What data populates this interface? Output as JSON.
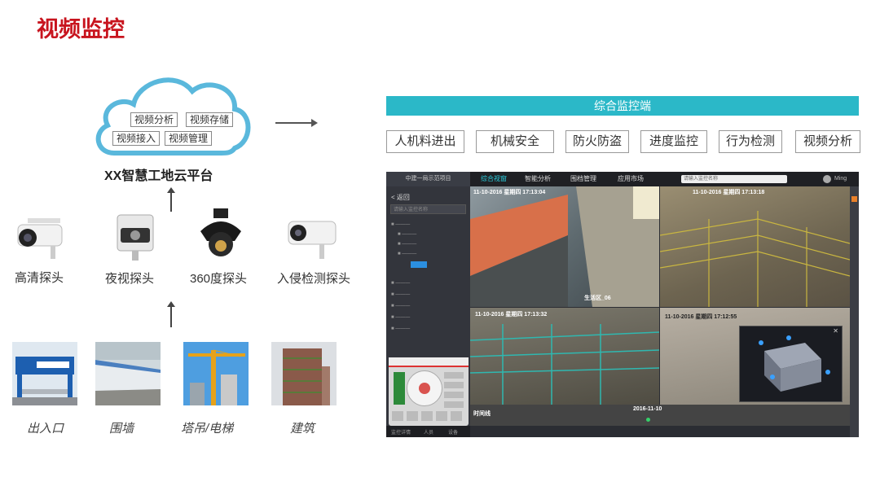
{
  "page_title": "视频监控",
  "cloud": {
    "tags": [
      "视频分析",
      "视频存储",
      "视频接入",
      "视频管理"
    ],
    "platform_name": "XX智慧工地云平台"
  },
  "cameras": [
    {
      "label": "高清探头",
      "icon": "bullet-camera-icon"
    },
    {
      "label": "夜视探头",
      "icon": "night-vision-camera-icon"
    },
    {
      "label": "360度探头",
      "icon": "dome-camera-icon"
    },
    {
      "label": "入侵检测探头",
      "icon": "intrusion-camera-icon"
    }
  ],
  "sites": [
    "出入口",
    "围墙",
    "塔吊/电梯",
    "建筑"
  ],
  "console": {
    "banner": "综合监控端",
    "functions": [
      "人机料进出",
      "机械安全",
      "防火防盗",
      "进度监控",
      "行为检测",
      "视频分析"
    ]
  },
  "screen": {
    "project": "中建一局示范项目",
    "tabs": [
      "综合视窗",
      "智能分析",
      "围档管理",
      "应用市场"
    ],
    "search_placeholder": "请输入监控名称",
    "user": "Ming",
    "back": "< 返回",
    "tree_search": "请输入监控名称",
    "timeline_label": "时间线",
    "timeline_date": "2016-11-10",
    "bottom_tabs": [
      "监控详情",
      "人员",
      "设备"
    ],
    "stamps": [
      "11-10-2016 星期四 17:13:04",
      "11-10-2016 星期四 17:13:18",
      "11-10-2016 星期四 17:13:32",
      "11-10-2016 星期四 17:12:55"
    ],
    "zone_label": "生活区_06",
    "colors": {
      "accent": "#2bd0e0",
      "banner": "#2bb8c8",
      "title": "#c8141e"
    }
  }
}
